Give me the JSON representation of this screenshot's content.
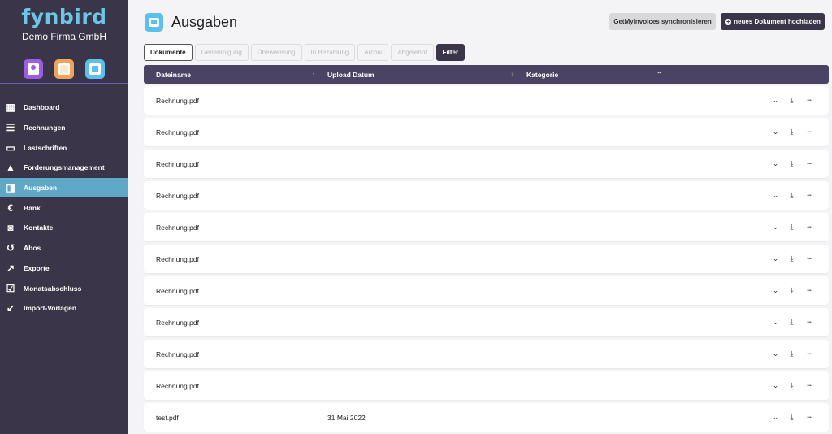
{
  "sidebar": {
    "logo": "fynbird",
    "company": "Demo Firma GmbH",
    "quick_actions": [
      {
        "icon": "contact-card-icon"
      },
      {
        "icon": "document-list-icon"
      },
      {
        "icon": "wallet-icon"
      }
    ],
    "items": [
      {
        "label": "Dashboard",
        "icon": "dashboard-icon",
        "glyph": "▦",
        "active": false
      },
      {
        "label": "Rechnungen",
        "icon": "invoice-icon",
        "glyph": "☰",
        "active": false
      },
      {
        "label": "Lastschriften",
        "icon": "credit-card-icon",
        "glyph": "▭",
        "active": false
      },
      {
        "label": "Forderungsmanagement",
        "icon": "warning-icon",
        "glyph": "▲",
        "active": false
      },
      {
        "label": "Ausgaben",
        "icon": "wallet-icon",
        "glyph": "◨",
        "active": true
      },
      {
        "label": "Bank",
        "icon": "euro-icon",
        "glyph": "€",
        "active": false
      },
      {
        "label": "Kontakte",
        "icon": "contact-icon",
        "glyph": "◙",
        "active": false
      },
      {
        "label": "Abos",
        "icon": "history-icon",
        "glyph": "↺",
        "active": false
      },
      {
        "label": "Exporte",
        "icon": "export-icon",
        "glyph": "↗",
        "active": false
      },
      {
        "label": "Monatsabschluss",
        "icon": "calendar-check-icon",
        "glyph": "☑",
        "active": false
      },
      {
        "label": "Import-Vorlagen",
        "icon": "import-icon",
        "glyph": "↙",
        "active": false
      }
    ]
  },
  "header": {
    "title": "Ausgaben",
    "sync_button": "GetMyInvoices synchronisieren",
    "upload_button": "neues Dokument hochladen"
  },
  "tabs": [
    {
      "label": "Dokumente",
      "state": "active"
    },
    {
      "label": "Genehmigung",
      "state": "disabled"
    },
    {
      "label": "Überweisung",
      "state": "disabled"
    },
    {
      "label": "In Bezahlung",
      "state": "disabled"
    },
    {
      "label": "Archiv",
      "state": "disabled"
    },
    {
      "label": "Abgelehnt",
      "state": "disabled"
    },
    {
      "label": "Filter",
      "state": "filter"
    }
  ],
  "table": {
    "columns": [
      "Dateiname",
      "Upload Datum",
      "Kategorie"
    ],
    "rows": [
      {
        "name": "Rechnung.pdf",
        "date": ""
      },
      {
        "name": "Rechnung.pdf",
        "date": ""
      },
      {
        "name": "Rechnung.pdf",
        "date": ""
      },
      {
        "name": "Rechnung.pdf",
        "date": ""
      },
      {
        "name": "Rechnung.pdf",
        "date": ""
      },
      {
        "name": "Rechnung.pdf",
        "date": ""
      },
      {
        "name": "Rechnung.pdf",
        "date": ""
      },
      {
        "name": "Rechnung.pdf",
        "date": ""
      },
      {
        "name": "Rechnung.pdf",
        "date": ""
      },
      {
        "name": "Rechnung.pdf",
        "date": ""
      },
      {
        "name": "test.pdf",
        "date": "31 Mai 2022"
      }
    ]
  },
  "colors": {
    "sidebar_bg": "#3a3548",
    "active_nav": "#5fa8c7",
    "brand": "#6cc6e8",
    "table_header": "#4b4363"
  }
}
